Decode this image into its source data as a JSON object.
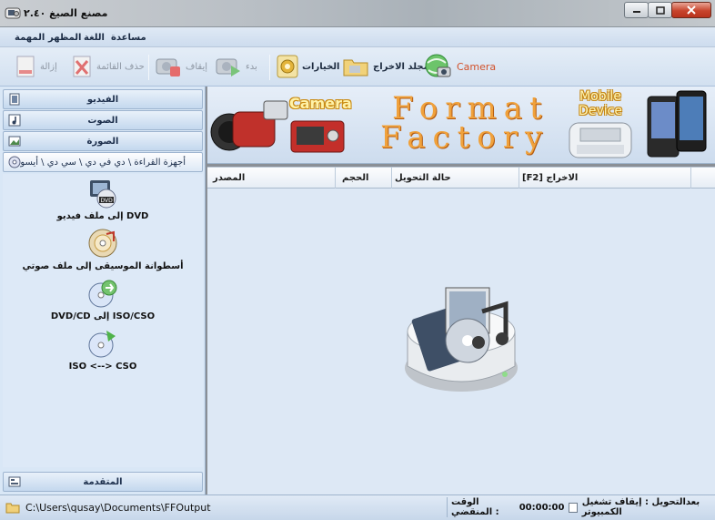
{
  "window": {
    "title": "مصنع الصيغ ٢.٤٠"
  },
  "menu": {
    "items": [
      "المهمة",
      "المظهر",
      "اللغة",
      "مساعدة"
    ]
  },
  "toolbar": {
    "remove": "إزالة",
    "clear_list": "حذف القائمة",
    "stop": "إيقاف",
    "start": "بدء",
    "options": "الخيارات",
    "output_folder": "مجلد الاخراج",
    "camera": "Camera"
  },
  "sidebar": {
    "video": "الفيديو",
    "audio": "الصوت",
    "picture": "الصورة",
    "rom_devices": "أجهزة القراءة \\ دي في دي \\ سي دي \\ أيسو",
    "advanced": "المتقدمة",
    "tools": [
      {
        "label": "إلى ملف فيديو DVD",
        "icon": "dvd-video-icon"
      },
      {
        "label": "أسطوانة الموسيقى إلى ملف صوتي",
        "icon": "music-cd-icon"
      },
      {
        "label": "DVD/CD إلى ISO/CSO",
        "icon": "disc-to-iso-icon"
      },
      {
        "label": "ISO <--> CSO",
        "icon": "iso-cso-icon"
      }
    ]
  },
  "banner": {
    "camera": "Camera",
    "format_line1": "Format",
    "format_line2": "Factory",
    "mobile_line1": "Mobile",
    "mobile_line2": "Device"
  },
  "table": {
    "headers": {
      "source": "المصدر",
      "size": "الحجم",
      "status": "حالة التحويل",
      "output": "[F2] الاخراج"
    }
  },
  "status": {
    "output_path": "C:\\Users\\qusay\\Documents\\FFOutput",
    "elapsed_label": "الوقت المنقضي :",
    "elapsed_value": "00:00:00",
    "after_convert": "بعدالتحويل : إيقاف تشغيل الكمبيوتر"
  },
  "colors": {
    "accent": "#d2512a",
    "panel": "#d9e7f6",
    "close_button": "#c8442c"
  }
}
